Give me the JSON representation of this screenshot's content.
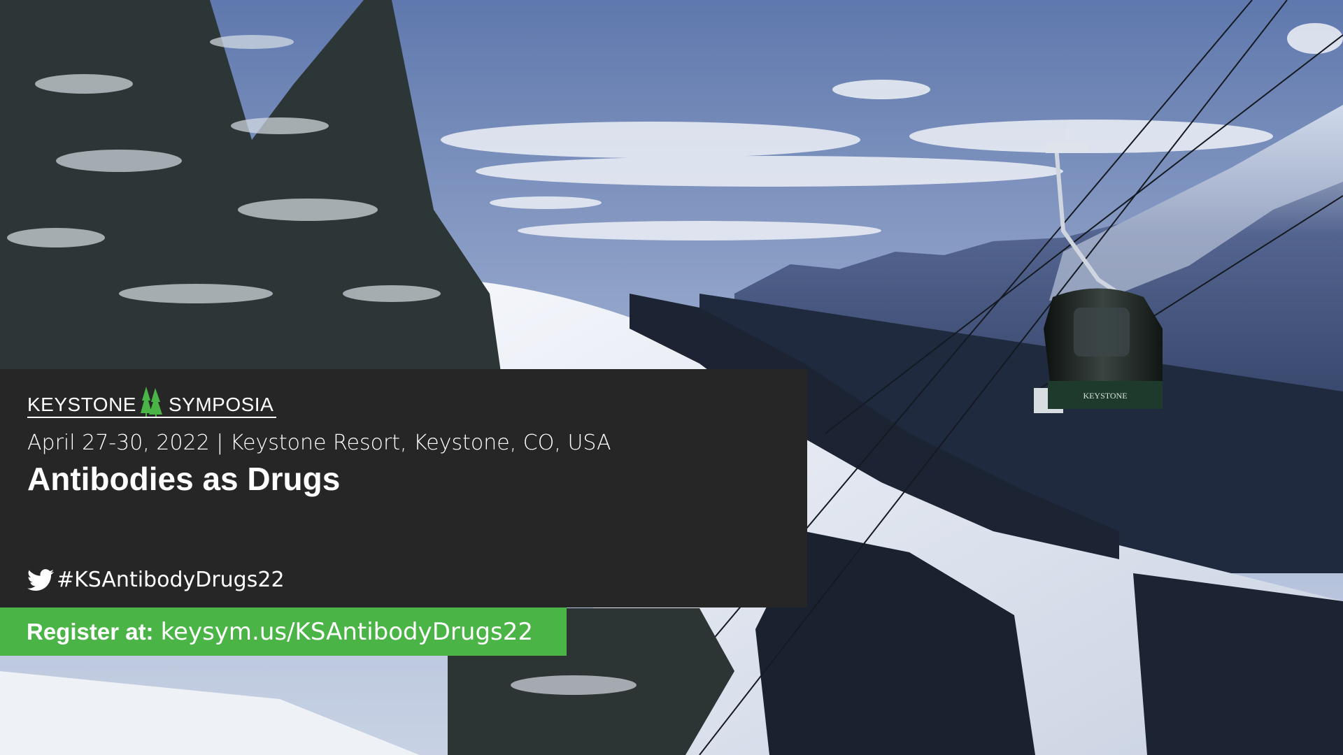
{
  "logo": {
    "left_word": "KEYSTONE",
    "right_word": "SYMPOSIA",
    "icon": "tree-icon"
  },
  "event": {
    "dates_location": "April 27-30, 2022 | Keystone Resort, Keystone, CO, USA",
    "title": "Antibodies as Drugs"
  },
  "social": {
    "icon": "twitter-icon",
    "hashtag": "#KSAntibodyDrugs22"
  },
  "register": {
    "label": "Register at:",
    "url": "keysym.us/KSAntibodyDrugs22"
  },
  "gondola_label": "KEYSTONE",
  "colors": {
    "panel": "#262626",
    "accent_green": "#4ab546",
    "text": "#ffffff"
  }
}
